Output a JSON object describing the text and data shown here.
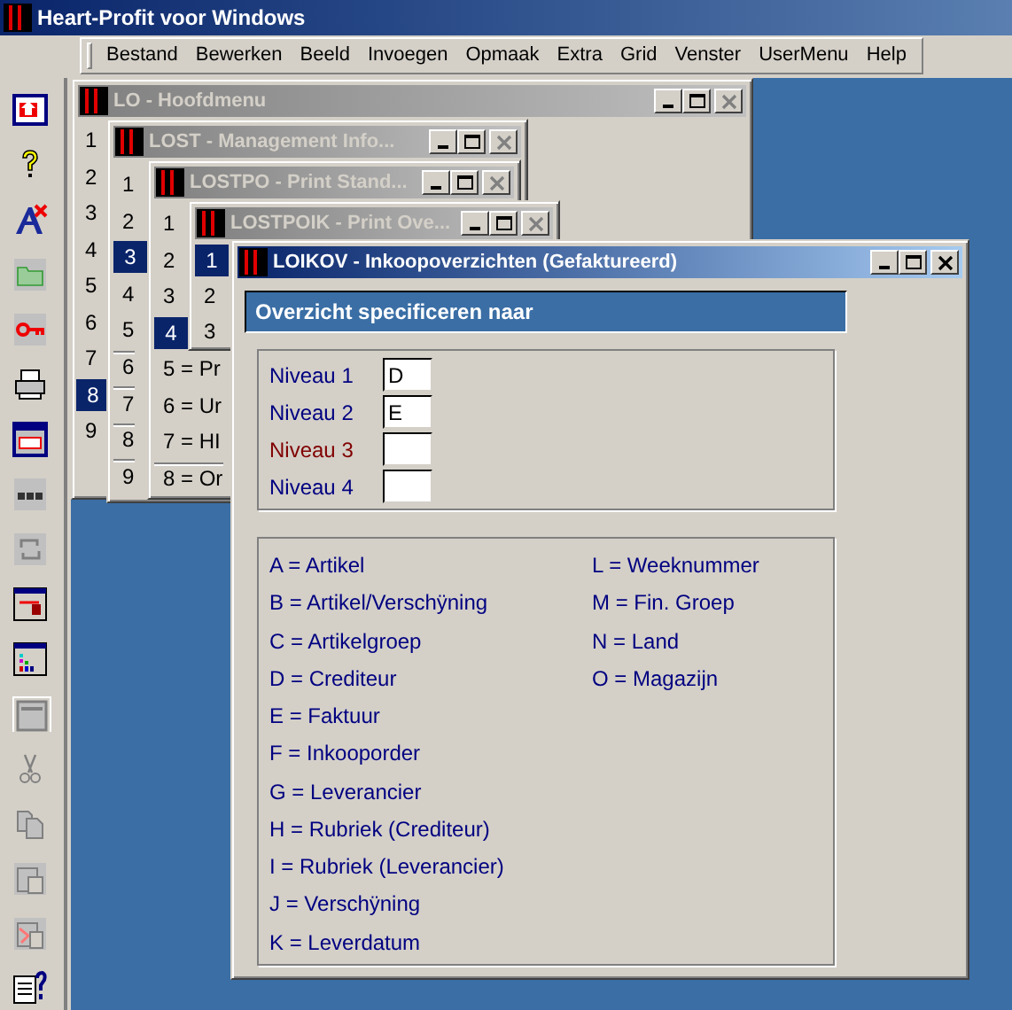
{
  "window": {
    "title": "Heart-Profit voor Windows"
  },
  "menu": [
    "Bestand",
    "Bewerken",
    "Beeld",
    "Invoegen",
    "Opmaak",
    "Extra",
    "Grid",
    "Venster",
    "UserMenu",
    "Help"
  ],
  "child_windows": [
    {
      "title": "LO - Hoofdmenu",
      "active": false,
      "rows": [
        {
          "label": "1",
          "selected": false,
          "divider": false
        },
        {
          "label": "2",
          "selected": false,
          "divider": false
        },
        {
          "label": "3",
          "selected": false,
          "divider": false
        },
        {
          "label": "4",
          "selected": false,
          "divider": false
        },
        {
          "label": "5",
          "selected": false,
          "divider": false
        },
        {
          "label": "6",
          "selected": false,
          "divider": false
        },
        {
          "label": "7",
          "selected": false,
          "divider": false
        },
        {
          "label": "8",
          "selected": true,
          "divider": false
        },
        {
          "label": "9",
          "selected": false,
          "divider": false
        }
      ]
    },
    {
      "title": "LOST - Management Info...",
      "active": false,
      "rows": [
        {
          "label": "1",
          "selected": false,
          "divider": false
        },
        {
          "label": "2",
          "selected": false,
          "divider": false
        },
        {
          "label": "3",
          "selected": true,
          "divider": false
        },
        {
          "label": "4",
          "selected": false,
          "divider": false
        },
        {
          "label": "5",
          "selected": false,
          "divider": false
        },
        {
          "label": "6",
          "selected": false,
          "divider": true
        },
        {
          "label": "7",
          "selected": false,
          "divider": true
        },
        {
          "label": "8",
          "selected": false,
          "divider": true
        },
        {
          "label": "9",
          "selected": false,
          "divider": true
        }
      ]
    },
    {
      "title": "LOSTPO - Print Stand...",
      "active": false,
      "rows": [
        {
          "label": "1",
          "selected": false,
          "divider": false
        },
        {
          "label": "2",
          "selected": false,
          "divider": false
        },
        {
          "label": "3",
          "selected": false,
          "divider": false
        },
        {
          "label": "4",
          "selected": true,
          "divider": false
        },
        {
          "label": "5 = Pr",
          "selected": false,
          "divider": false
        },
        {
          "label": "6 = Ur",
          "selected": false,
          "divider": false
        },
        {
          "label": "7 = HI",
          "selected": false,
          "divider": false
        },
        {
          "label": "8 = Or",
          "selected": false,
          "divider": true
        }
      ]
    },
    {
      "title": "LOSTPOIK - Print Ove...",
      "active": false,
      "rows": [
        {
          "label": "1",
          "selected": true,
          "divider": false
        },
        {
          "label": "2",
          "selected": false,
          "divider": false
        },
        {
          "label": "3",
          "selected": false,
          "divider": false
        }
      ]
    }
  ],
  "dialog": {
    "title": "LOIKOV - Inkoopoverzichten (Gefaktureerd)",
    "active": true,
    "header": "Overzicht specificeren naar",
    "levels": [
      {
        "label": "Niveau 1",
        "value": "D",
        "color": "#000080"
      },
      {
        "label": "Niveau 2",
        "value": "E",
        "color": "#000080"
      },
      {
        "label": "Niveau 3",
        "color": "#800000"
      },
      {
        "label": "Niveau 4",
        "color": "#000080"
      }
    ],
    "codes_left": [
      "A = Artikel",
      "B = Artikel/Verschÿning",
      "C = Artikelgroep",
      "D = Crediteur",
      "E = Faktuur",
      "F = Inkooporder",
      "G = Leverancier",
      "H = Rubriek (Crediteur)",
      "I = Rubriek (Leverancier)",
      "J = Verschÿning",
      "K = Leverdatum"
    ],
    "codes_right": [
      "L = Weeknummer",
      "M = Fin. Groep",
      "N = Land",
      "O = Magazijn"
    ]
  }
}
